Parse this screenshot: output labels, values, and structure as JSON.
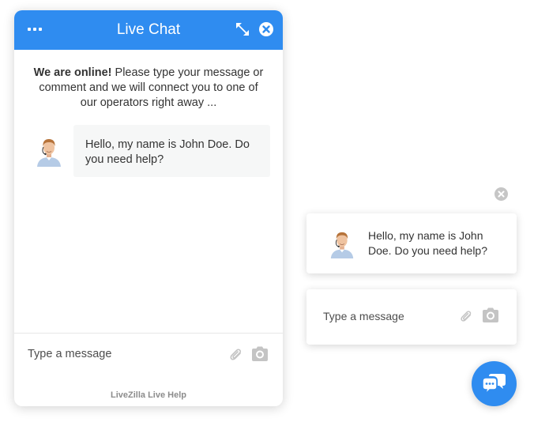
{
  "chat": {
    "title": "Live Chat",
    "welcome_bold": "We are online!",
    "welcome_rest": " Please type your message or comment and we will connect you to one of our operators right away ...",
    "operator_message": "Hello, my name is John Doe. Do you need help?",
    "input_placeholder": "Type a message",
    "branding": "LiveZilla Live Help"
  },
  "widget": {
    "preview_message": "Hello, my name is John Doe. Do you need help?",
    "input_placeholder": "Type a message"
  },
  "icons": {
    "menu": "menu-dots-icon",
    "expand": "expand-icon",
    "close": "close-icon",
    "attach": "paperclip-icon",
    "camera": "camera-icon",
    "chat": "chat-bubbles-icon"
  },
  "colors": {
    "accent": "#2f8cf0",
    "bubble_bg": "#f6f7f7",
    "icon_gray": "#c4c4c4",
    "branding_text": "#8c8c8c"
  }
}
